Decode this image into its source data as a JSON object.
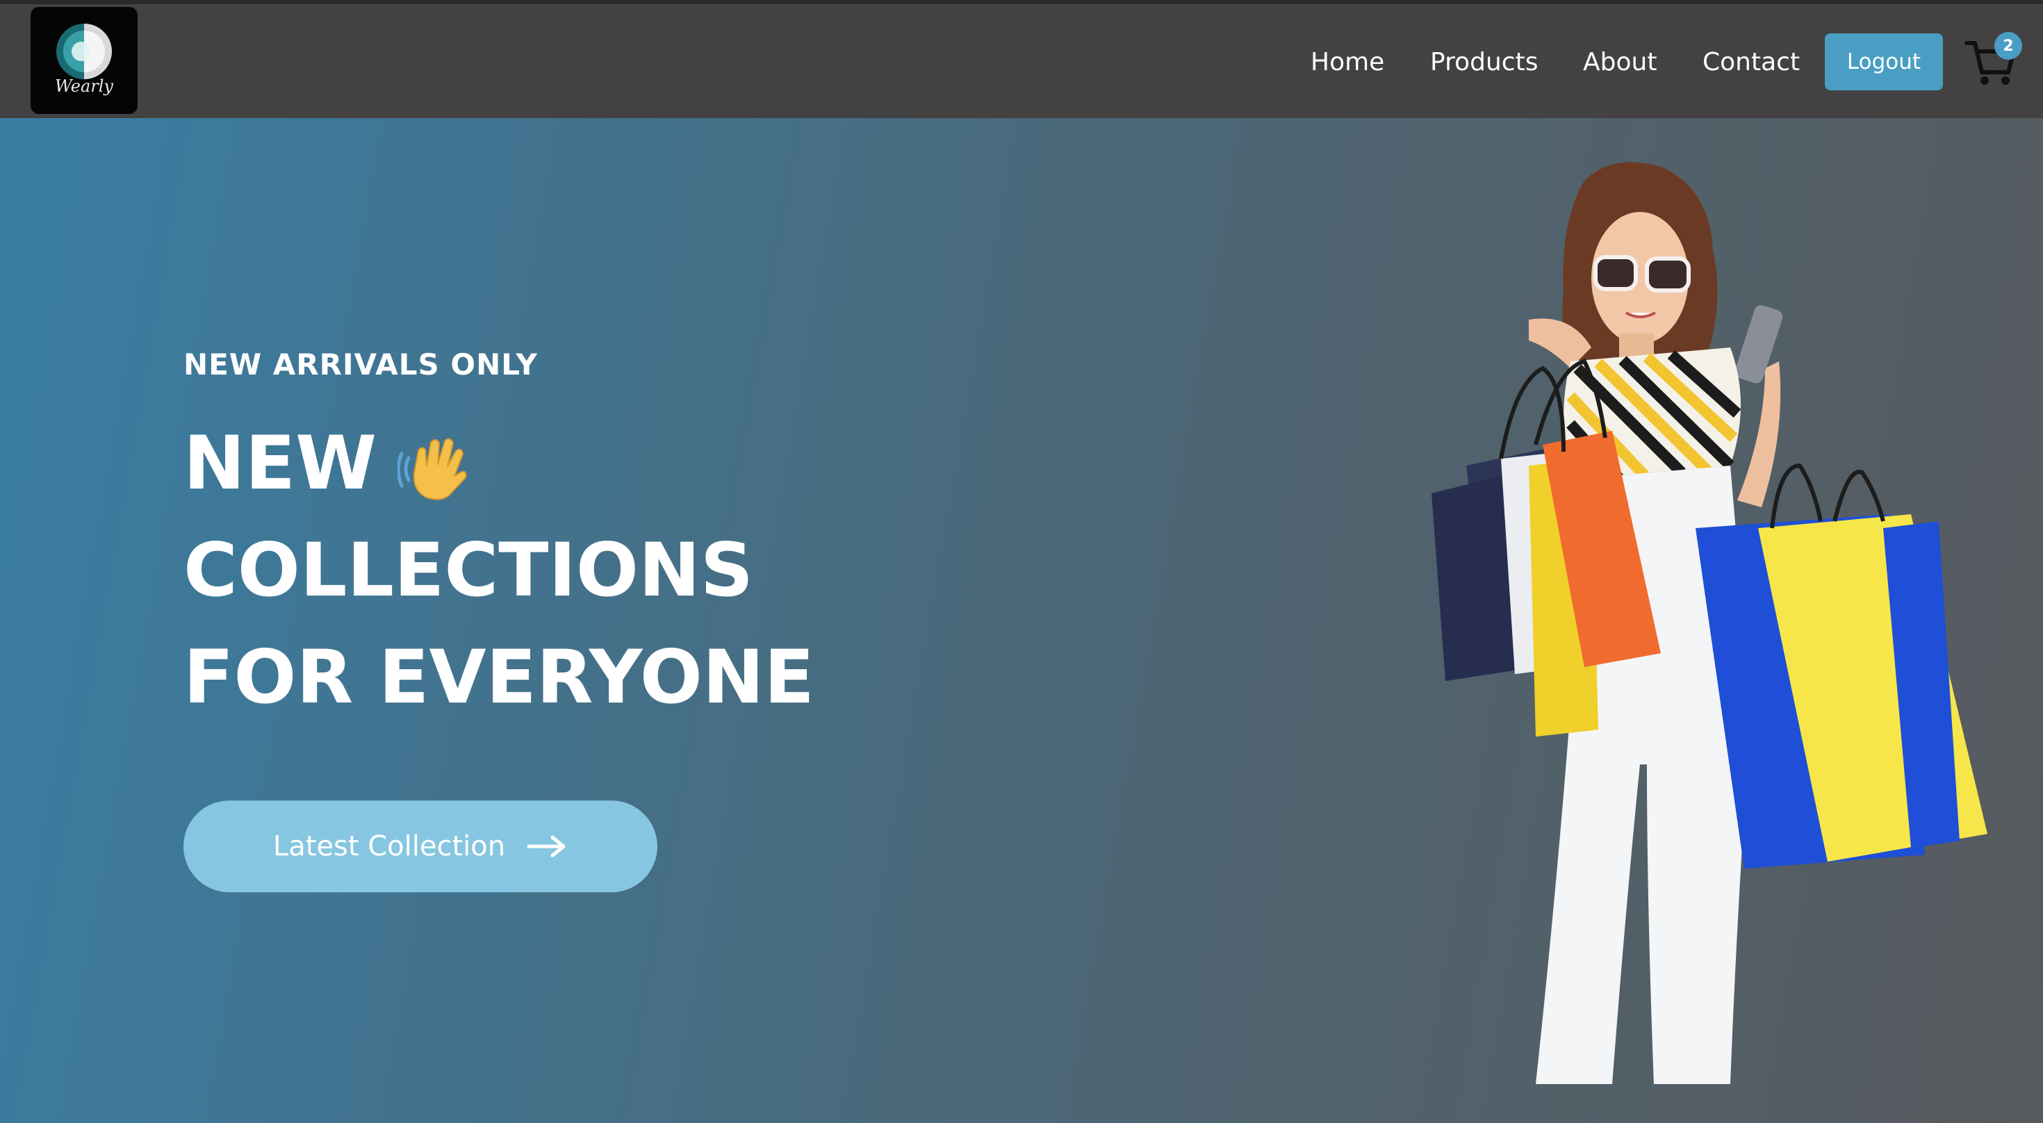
{
  "nav": {
    "logo_text": "Wearly",
    "links": [
      "Home",
      "Products",
      "About",
      "Contact"
    ],
    "logout_label": "Logout",
    "cart_count": "2",
    "cart_icon": "shopping-cart-icon"
  },
  "hero": {
    "eyebrow": "NEW ARRIVALS ONLY",
    "headline": [
      "NEW",
      "COLLECTIONS",
      "FOR EVERYONE"
    ],
    "wave_icon": "waving-hand-icon",
    "cta_label": "Latest Collection",
    "cta_icon": "arrow-right-icon"
  },
  "colors": {
    "accent": "#4a9ec3",
    "cta": "#87c6e0",
    "navbar": "#434142"
  }
}
